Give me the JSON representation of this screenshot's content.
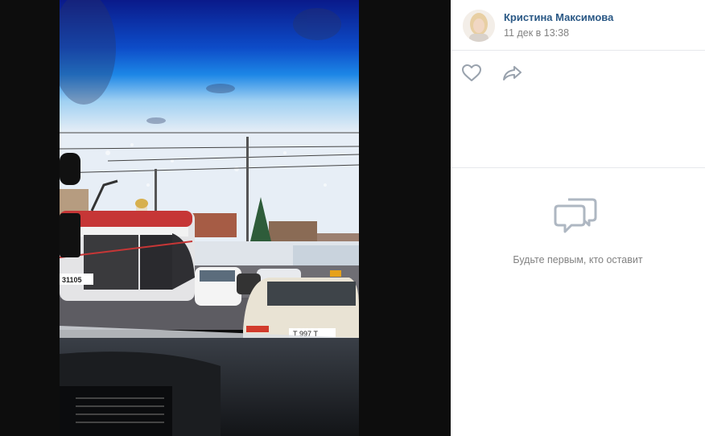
{
  "post": {
    "author_name": "Кристина Максимова",
    "date": "11 дек в 13:38"
  },
  "photo": {
    "tram_number": "31105",
    "plate_text": "Т 997 Т"
  },
  "actions": {
    "like_icon": "heart-icon",
    "share_icon": "share-arrow-icon"
  },
  "comments": {
    "icon": "speech-bubbles-icon",
    "empty_text": "Будьте первым, кто оставит"
  },
  "colors": {
    "link": "#2a5885",
    "muted": "#828282",
    "icon": "#99a2ad",
    "divider": "#e7e8ec"
  }
}
